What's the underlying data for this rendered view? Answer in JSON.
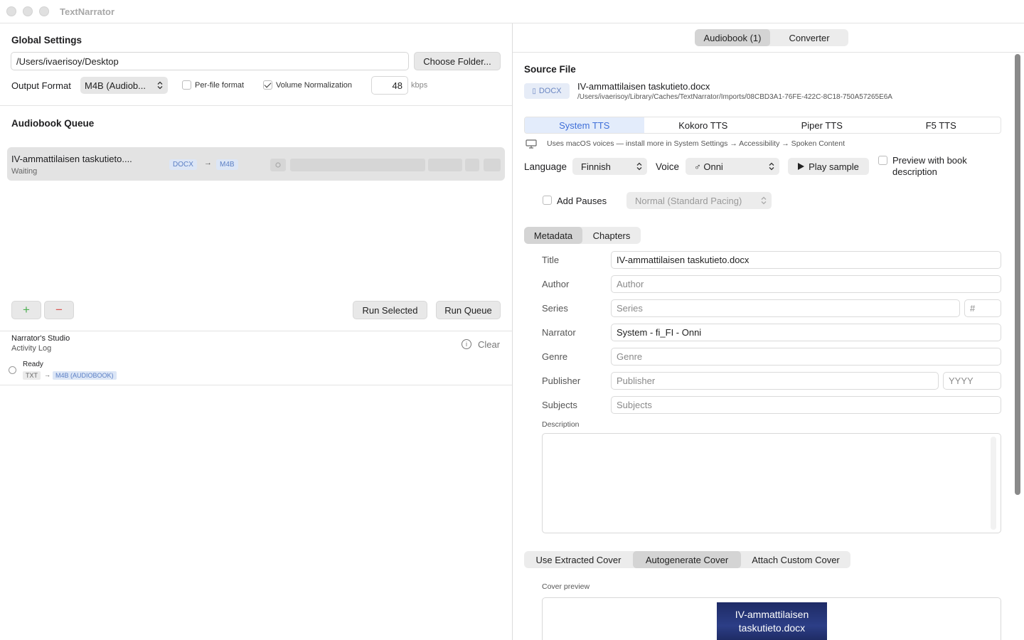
{
  "window": {
    "title": "TextNarrator"
  },
  "global_settings": {
    "heading": "Global Settings",
    "folder_path": "/Users/ivaerisoy/Desktop",
    "choose_folder": "Choose Folder...",
    "output_format_label": "Output Format",
    "output_format_value": "M4B (Audiob...",
    "per_file_format": "Per-file format",
    "per_file_checked": false,
    "volume_normalization": "Volume Normalization",
    "volume_checked": true,
    "bitrate": "48",
    "bitrate_unit": "kbps"
  },
  "queue": {
    "heading": "Audiobook Queue",
    "items": [
      {
        "name": "IV-ammattilaisen taskutieto....",
        "status": "Waiting",
        "from": "DOCX",
        "to": "M4B"
      }
    ],
    "add": "+",
    "remove": "−",
    "run_selected": "Run Selected",
    "run_queue": "Run Queue"
  },
  "log": {
    "title": "Narrator's Studio",
    "subtitle": "Activity Log",
    "clear": "Clear",
    "entries": [
      {
        "status": "Ready",
        "from": "TXT",
        "to": "M4B (AUDIOBOOK)"
      }
    ]
  },
  "mode_tabs": {
    "items": [
      "Audiobook (1)",
      "Converter"
    ],
    "selected": "Audiobook (1)"
  },
  "source": {
    "heading": "Source File",
    "badge": "DOCX",
    "filename": "IV-ammattilaisen taskutieto.docx",
    "path": "/Users/ivaerisoy/Library/Caches/TextNarrator/Imports/08CBD3A1-76FE-422C-8C18-750A57265E6A"
  },
  "tts_tabs": {
    "items": [
      "System TTS",
      "Kokoro TTS",
      "Piper TTS",
      "F5 TTS"
    ],
    "selected": "System TTS"
  },
  "tts_note": "Uses macOS voices — install more in System Settings → Accessibility → Spoken Content",
  "voice": {
    "language_label": "Language",
    "language": "Finnish",
    "voice_label": "Voice",
    "voice": "♂ Onni",
    "play_sample": "Play sample",
    "preview_label": "Preview with book description",
    "add_pauses": "Add Pauses",
    "pacing": "Normal (Standard Pacing)"
  },
  "meta_tabs": {
    "items": [
      "Metadata",
      "Chapters"
    ],
    "selected": "Metadata"
  },
  "metadata": {
    "title_label": "Title",
    "title_value": "IV-ammattilaisen taskutieto.docx",
    "author_label": "Author",
    "author_ph": "Author",
    "series_label": "Series",
    "series_ph": "Series",
    "series_num_ph": "#",
    "narrator_label": "Narrator",
    "narrator_value": "System - fi_FI - Onni",
    "genre_label": "Genre",
    "genre_ph": "Genre",
    "publisher_label": "Publisher",
    "publisher_ph": "Publisher",
    "year_ph": "YYYY",
    "subjects_label": "Subjects",
    "subjects_ph": "Subjects",
    "description_label": "Description"
  },
  "cover": {
    "tabs": [
      "Use Extracted Cover",
      "Autogenerate Cover",
      "Attach Custom Cover"
    ],
    "selected": "Autogenerate Cover",
    "preview_label": "Cover preview",
    "preview_line1": "IV-ammattilaisen",
    "preview_line2": "taskutieto.docx"
  }
}
